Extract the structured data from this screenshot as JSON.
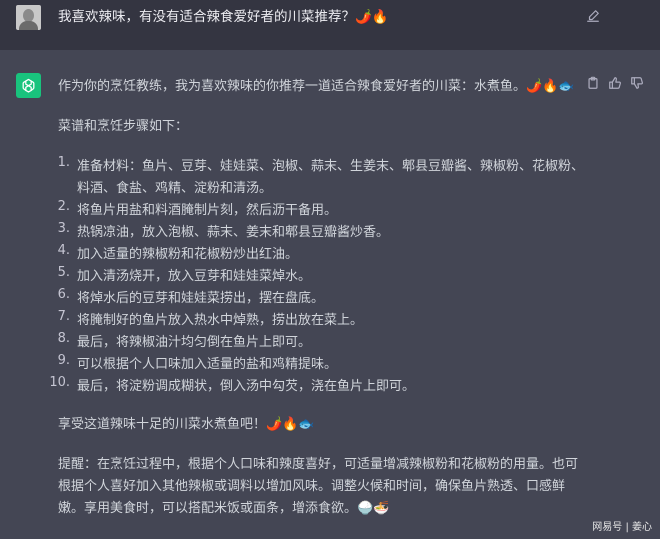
{
  "user_message": {
    "text": "我喜欢辣味，有没有适合辣食爱好者的川菜推荐？🌶️🔥"
  },
  "assistant_message": {
    "intro": "作为你的烹饪教练，我为喜欢辣味的你推荐一道适合辣食爱好者的川菜：水煮鱼。🌶️🔥🐟",
    "steps_heading": "菜谱和烹饪步骤如下：",
    "steps": [
      {
        "num": "1.",
        "line1": "准备材料：鱼片、豆芽、娃娃菜、泡椒、蒜末、生姜末、郫县豆瓣酱、辣椒粉、花椒粉、",
        "line2": "料酒、食盐、鸡精、淀粉和清汤。"
      },
      {
        "num": "2.",
        "line1": "将鱼片用盐和料酒腌制片刻，然后沥干备用。"
      },
      {
        "num": "3.",
        "line1": "热锅凉油，放入泡椒、蒜末、姜末和郫县豆瓣酱炒香。"
      },
      {
        "num": "4.",
        "line1": "加入适量的辣椒粉和花椒粉炒出红油。"
      },
      {
        "num": "5.",
        "line1": "加入清汤烧开，放入豆芽和娃娃菜焯水。"
      },
      {
        "num": "6.",
        "line1": "将焯水后的豆芽和娃娃菜捞出，摆在盘底。"
      },
      {
        "num": "7.",
        "line1": "将腌制好的鱼片放入热水中焯熟，捞出放在菜上。"
      },
      {
        "num": "8.",
        "line1": "最后，将辣椒油汁均匀倒在鱼片上即可。"
      },
      {
        "num": "9.",
        "line1": "可以根据个人口味加入适量的盐和鸡精提味。"
      },
      {
        "num": "10.",
        "line1": "最后，将淀粉调成糊状，倒入汤中勾芡，浇在鱼片上即可。"
      }
    ],
    "closing": "享受这道辣味十足的川菜水煮鱼吧！🌶️🔥🐟",
    "tip_line1": "提醒：在烹饪过程中，根据个人口味和辣度喜好，可适量增减辣椒粉和花椒粉的用量。也可",
    "tip_line2": "根据个人喜好加入其他辣椒或调料以增加风味。调整火候和时间，确保鱼片熟透、口感鲜",
    "tip_line3": "嫩。享用美食时，可以搭配米饭或面条，增添食欲。🍚🍜"
  },
  "icons": {
    "edit": "edit-icon",
    "copy": "clipboard-icon",
    "like": "thumbs-up-icon",
    "dislike": "thumbs-down-icon",
    "assistant": "openai-logo-icon"
  },
  "watermark": {
    "text": "网易号 | 姜心"
  },
  "colors": {
    "user_bg": "#343541",
    "assistant_bg": "#444654",
    "avatar_green": "#19c37d"
  }
}
